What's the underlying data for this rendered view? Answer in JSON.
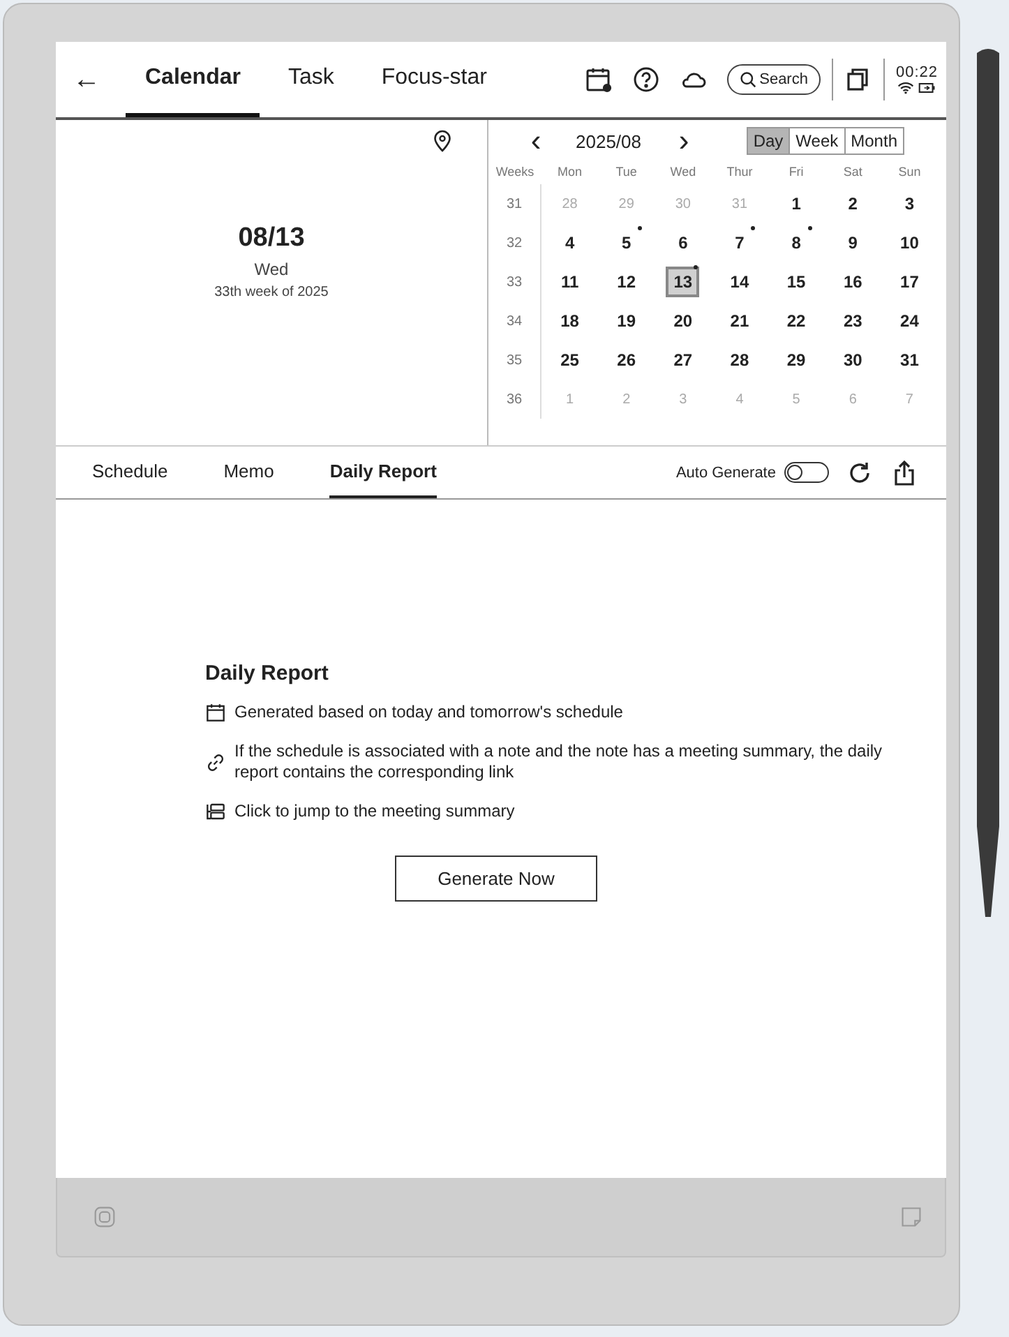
{
  "header": {
    "back": "←",
    "tabs": [
      {
        "label": "Calendar",
        "selected": true
      },
      {
        "label": "Task",
        "selected": false
      },
      {
        "label": "Focus-star",
        "selected": false
      }
    ],
    "search": "Search",
    "time": "00:22"
  },
  "day_panel": {
    "date": "08/13",
    "weekday": "Wed",
    "week": "33th week of 2025"
  },
  "calendar": {
    "prev": "‹",
    "month": "2025/08",
    "next": "›",
    "views": [
      {
        "label": "Day",
        "selected": true
      },
      {
        "label": "Week",
        "selected": false
      },
      {
        "label": "Month",
        "selected": false
      }
    ],
    "weeks_heading": "Weeks",
    "weekdays": [
      "Mon",
      "Tue",
      "Wed",
      "Thur",
      "Fri",
      "Sat",
      "Sun"
    ],
    "weeks": [
      {
        "number": "31",
        "days": [
          {
            "label": "28",
            "muted": true,
            "dot": false,
            "selected": false
          },
          {
            "label": "29",
            "muted": true,
            "dot": false,
            "selected": false
          },
          {
            "label": "30",
            "muted": true,
            "dot": false,
            "selected": false
          },
          {
            "label": "31",
            "muted": true,
            "dot": false,
            "selected": false
          },
          {
            "label": "1",
            "muted": false,
            "dot": false,
            "selected": false
          },
          {
            "label": "2",
            "muted": false,
            "dot": false,
            "selected": false
          },
          {
            "label": "3",
            "muted": false,
            "dot": false,
            "selected": false
          }
        ]
      },
      {
        "number": "32",
        "days": [
          {
            "label": "4",
            "muted": false,
            "dot": false,
            "selected": false
          },
          {
            "label": "5",
            "muted": false,
            "dot": true,
            "selected": false
          },
          {
            "label": "6",
            "muted": false,
            "dot": false,
            "selected": false
          },
          {
            "label": "7",
            "muted": false,
            "dot": true,
            "selected": false
          },
          {
            "label": "8",
            "muted": false,
            "dot": true,
            "selected": false
          },
          {
            "label": "9",
            "muted": false,
            "dot": false,
            "selected": false
          },
          {
            "label": "10",
            "muted": false,
            "dot": false,
            "selected": false
          }
        ]
      },
      {
        "number": "33",
        "days": [
          {
            "label": "11",
            "muted": false,
            "dot": false,
            "selected": false
          },
          {
            "label": "12",
            "muted": false,
            "dot": false,
            "selected": false
          },
          {
            "label": "13",
            "muted": false,
            "dot": true,
            "selected": true
          },
          {
            "label": "14",
            "muted": false,
            "dot": false,
            "selected": false
          },
          {
            "label": "15",
            "muted": false,
            "dot": false,
            "selected": false
          },
          {
            "label": "16",
            "muted": false,
            "dot": false,
            "selected": false
          },
          {
            "label": "17",
            "muted": false,
            "dot": false,
            "selected": false
          }
        ]
      },
      {
        "number": "34",
        "days": [
          {
            "label": "18",
            "muted": false,
            "dot": false,
            "selected": false
          },
          {
            "label": "19",
            "muted": false,
            "dot": false,
            "selected": false
          },
          {
            "label": "20",
            "muted": false,
            "dot": false,
            "selected": false
          },
          {
            "label": "21",
            "muted": false,
            "dot": false,
            "selected": false
          },
          {
            "label": "22",
            "muted": false,
            "dot": false,
            "selected": false
          },
          {
            "label": "23",
            "muted": false,
            "dot": false,
            "selected": false
          },
          {
            "label": "24",
            "muted": false,
            "dot": false,
            "selected": false
          }
        ]
      },
      {
        "number": "35",
        "days": [
          {
            "label": "25",
            "muted": false,
            "dot": false,
            "selected": false
          },
          {
            "label": "26",
            "muted": false,
            "dot": false,
            "selected": false
          },
          {
            "label": "27",
            "muted": false,
            "dot": false,
            "selected": false
          },
          {
            "label": "28",
            "muted": false,
            "dot": false,
            "selected": false
          },
          {
            "label": "29",
            "muted": false,
            "dot": false,
            "selected": false
          },
          {
            "label": "30",
            "muted": false,
            "dot": false,
            "selected": false
          },
          {
            "label": "31",
            "muted": false,
            "dot": false,
            "selected": false
          }
        ]
      },
      {
        "number": "36",
        "days": [
          {
            "label": "1",
            "muted": true,
            "dot": false,
            "selected": false
          },
          {
            "label": "2",
            "muted": true,
            "dot": false,
            "selected": false
          },
          {
            "label": "3",
            "muted": true,
            "dot": false,
            "selected": false
          },
          {
            "label": "4",
            "muted": true,
            "dot": false,
            "selected": false
          },
          {
            "label": "5",
            "muted": true,
            "dot": false,
            "selected": false
          },
          {
            "label": "6",
            "muted": true,
            "dot": false,
            "selected": false
          },
          {
            "label": "7",
            "muted": true,
            "dot": false,
            "selected": false
          }
        ]
      }
    ]
  },
  "sub_tabs": [
    {
      "label": "Schedule",
      "selected": false
    },
    {
      "label": "Memo",
      "selected": false
    },
    {
      "label": "Daily Report",
      "selected": true
    }
  ],
  "auto_generate": {
    "label": "Auto Generate",
    "on": false
  },
  "report": {
    "title": "Daily Report",
    "items": [
      {
        "kind": "calendar",
        "text": "Generated based on today and tomorrow's schedule"
      },
      {
        "kind": "link",
        "text": "If the schedule is associated with a note and the note has a meeting summary, the daily report contains the corresponding link"
      },
      {
        "kind": "summary",
        "text": "Click to jump to the meeting summary"
      }
    ],
    "button": "Generate Now"
  }
}
